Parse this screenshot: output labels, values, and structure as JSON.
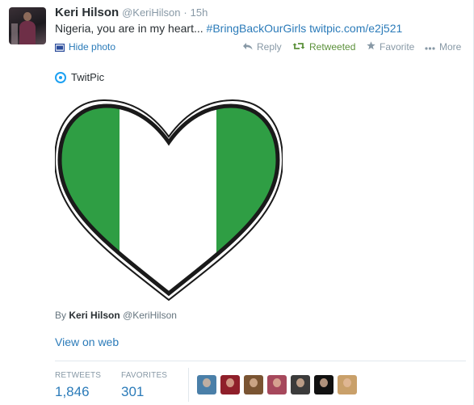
{
  "tweet": {
    "author_name": "Keri Hilson",
    "author_handle": "@KeriHilson",
    "separator": "·",
    "time": "15h",
    "text_plain": "Nigeria, you are in my heart... ",
    "hashtag": "#BringBackOurGirls",
    "link": "twitpic.com/e2j521"
  },
  "actions": {
    "hide_photo": "Hide photo",
    "reply": "Reply",
    "retweeted": "Retweeted",
    "favorite": "Favorite",
    "more": "More"
  },
  "media": {
    "provider": "TwitPic",
    "byline_prefix": "By",
    "byline_name": "Keri Hilson",
    "byline_handle": "@KeriHilson",
    "view_on_web": "View on web",
    "flag_colors": {
      "green": "#2f9e44",
      "white": "#ffffff",
      "outline": "#1a1a1a"
    }
  },
  "stats": {
    "retweets_label": "RETWEETS",
    "retweets_value": "1,846",
    "favorites_label": "FAVORITES",
    "favorites_value": "301"
  },
  "favoriters": [
    {
      "name": "user-avatar-1",
      "color": "#4a7fa8"
    },
    {
      "name": "user-avatar-2",
      "color": "#8f1f2a"
    },
    {
      "name": "user-avatar-3",
      "color": "#7a5432"
    },
    {
      "name": "user-avatar-4",
      "color": "#a6485c"
    },
    {
      "name": "user-avatar-5",
      "color": "#3b3b3b"
    },
    {
      "name": "user-avatar-6",
      "color": "#111111"
    },
    {
      "name": "user-avatar-7",
      "color": "#c9a06a"
    }
  ],
  "colors": {
    "link": "#2b7bb9",
    "retweeted": "#5c913b",
    "muted": "#8899a6"
  }
}
